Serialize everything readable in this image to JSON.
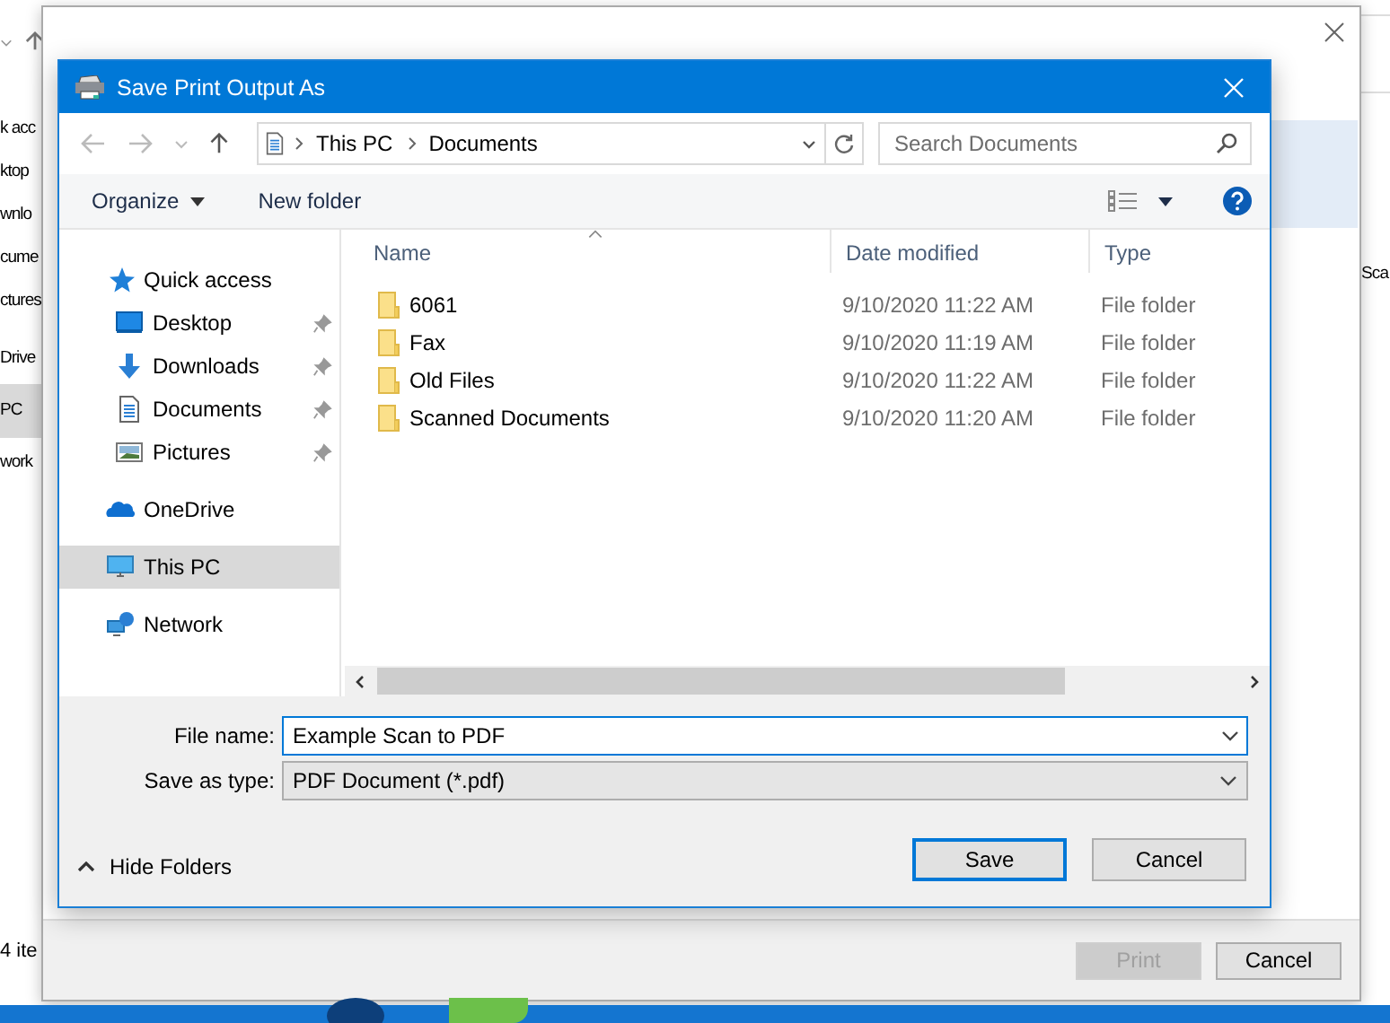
{
  "background_explorer": {
    "nav_items": [
      {
        "label": "k acc",
        "selected": false
      },
      {
        "label": "ktop",
        "selected": false
      },
      {
        "label": "wnlo",
        "selected": false
      },
      {
        "label": "cume",
        "selected": false
      },
      {
        "label": "ctures",
        "selected": false
      },
      {
        "label": "Drive",
        "selected": false
      },
      {
        "label": "PC",
        "selected": true
      },
      {
        "label": "work",
        "selected": false
      }
    ],
    "status": "4 ite",
    "column_text": "Sca"
  },
  "print_dialog": {
    "buttons": [
      {
        "label": "Print",
        "disabled": true
      },
      {
        "label": "Cancel",
        "disabled": false
      }
    ]
  },
  "dialog": {
    "title": "Save Print Output As",
    "breadcrumb": [
      "This PC",
      "Documents"
    ],
    "search": {
      "placeholder": "Search Documents"
    },
    "toolbar": {
      "organize": "Organize",
      "new_folder": "New folder"
    },
    "sidebar": [
      {
        "label": "Quick access",
        "kind": "star",
        "selected": false,
        "children": [
          {
            "label": "Desktop",
            "kind": "desktop",
            "pinned": true,
            "selected": false
          },
          {
            "label": "Downloads",
            "kind": "download",
            "pinned": true,
            "selected": false
          },
          {
            "label": "Documents",
            "kind": "document",
            "pinned": true,
            "selected": false
          },
          {
            "label": "Pictures",
            "kind": "pictures",
            "pinned": true,
            "selected": false
          }
        ]
      },
      {
        "label": "OneDrive",
        "kind": "cloud",
        "selected": false
      },
      {
        "label": "This PC",
        "kind": "pc",
        "selected": true
      },
      {
        "label": "Network",
        "kind": "network",
        "selected": false
      }
    ],
    "table": {
      "columns": [
        "Name",
        "Date modified",
        "Type"
      ],
      "rows": [
        {
          "name": "6061",
          "date": "9/10/2020 11:22 AM",
          "type": "File folder"
        },
        {
          "name": "Fax",
          "date": "9/10/2020 11:19 AM",
          "type": "File folder"
        },
        {
          "name": "Old Files",
          "date": "9/10/2020 11:22 AM",
          "type": "File folder"
        },
        {
          "name": "Scanned Documents",
          "date": "9/10/2020 11:20 AM",
          "type": "File folder"
        }
      ]
    },
    "file_name": {
      "label": "File name:",
      "value": "Example Scan to PDF"
    },
    "save_as_type": {
      "label": "Save as type:",
      "value": "PDF Document (*.pdf)"
    },
    "hide_folders": "Hide Folders",
    "buttons": [
      {
        "label": "Save",
        "default": true
      },
      {
        "label": "Cancel",
        "default": false
      }
    ]
  }
}
